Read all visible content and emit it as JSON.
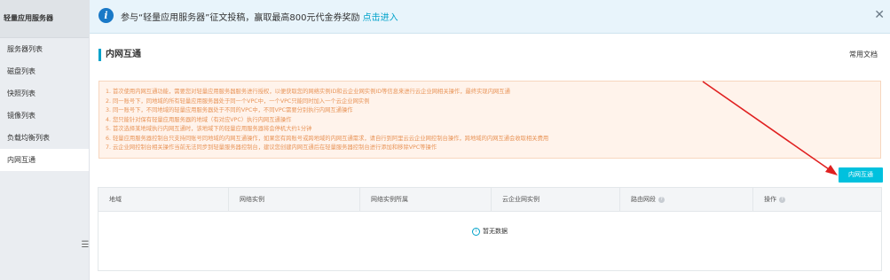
{
  "sidebar": {
    "title": "轻量应用服务器",
    "items": [
      {
        "label": "服务器列表"
      },
      {
        "label": "磁盘列表"
      },
      {
        "label": "快照列表"
      },
      {
        "label": "镜像列表"
      },
      {
        "label": "负载均衡列表"
      },
      {
        "label": "内网互通",
        "active": true
      }
    ],
    "collapse_icon": "hamburger-icon"
  },
  "banner": {
    "icon": "info-icon",
    "text": "参与“轻量应用服务器”征文投稿，赢取最高800元代金券奖励",
    "link": "点击进入",
    "close_icon": "close-icon"
  },
  "page": {
    "title": "内网互通",
    "doc_link": "常用文档"
  },
  "notice": {
    "lines": [
      "1. 首次使用内网互通功能，需要您对轻量应用服务器服务进行授权，以便获取您的网络实例ID和云企业网实例ID等信息来进行云企业网相关操作，最终实现内网互通",
      "2. 同一账号下，同地域的所有轻量应用服务器处于同一个VPC中，一个VPC只能同时加入一个云企业网实例",
      "3. 同一账号下，不同地域的轻量应用服务器处于不同的VPC中，不同VPC需要分别执行内网互通操作",
      "4. 您只能针对保有轻量应用服务器的地域（有对应VPC）执行内网互通操作",
      "5. 首次选择某地域执行内网互通时，该地域下的轻量应用服务器将会停机大约1分钟",
      "6. 轻量应用服务器控制台只支持同账号同地域的内网互通操作，如果您有跨账号或跨地域的内网互通需求，请自行到阿里云云企业网控制台操作，跨地域的内网互通会收取相关费用",
      "7. 云企业网控制台相关操作当前无法同步到轻量服务器控制台，建议您创建内网互通后在轻量服务器控制台进行添加和移除VPC等操作"
    ],
    "color": "#e89458"
  },
  "action_button": {
    "label": "内网互通",
    "color": "#00c1de"
  },
  "table": {
    "columns": [
      {
        "label": "地域",
        "help": false
      },
      {
        "label": "网络实例",
        "help": false
      },
      {
        "label": "网络实例所属",
        "help": false
      },
      {
        "label": "云企业网实例",
        "help": false
      },
      {
        "label": "路由网段",
        "help": true
      },
      {
        "label": "操作",
        "help": true
      }
    ],
    "empty_text": "暂无数据"
  },
  "annotation": {
    "arrow_color": "#e02020"
  }
}
